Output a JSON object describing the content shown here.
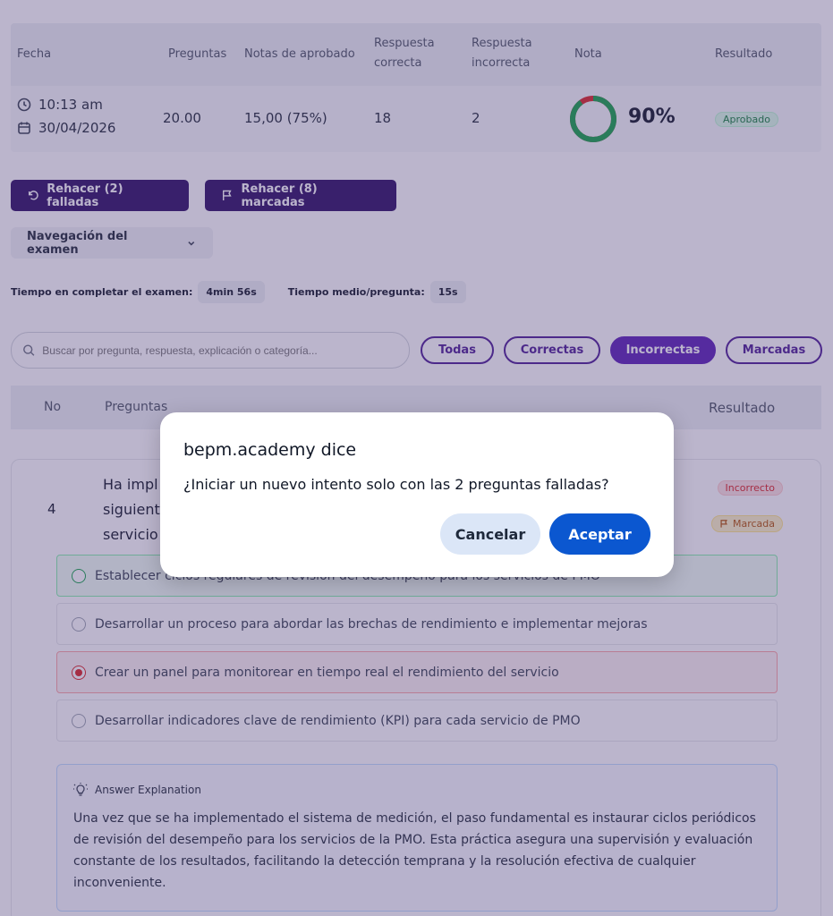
{
  "summary": {
    "headers": {
      "fecha": "Fecha",
      "preguntas": "Preguntas",
      "notas_aprobado": "Notas de aprobado",
      "respuesta_correcta_1": "Respuesta",
      "respuesta_correcta_2": "correcta",
      "respuesta_incorrecta_1": "Respuesta",
      "respuesta_incorrecta_2": "incorrecta",
      "nota": "Nota",
      "resultado": "Resultado"
    },
    "row": {
      "time": "10:13 am",
      "date": "30/04/2026",
      "preguntas": "20.00",
      "notas_aprobado": "15,00 (75%)",
      "correctas": "18",
      "incorrectas": "2",
      "nota_pct": "90%",
      "nota_value": 0.9,
      "resultado": "Aprobado"
    }
  },
  "actions": {
    "retry_failed": "Rehacer (2) falladas",
    "retry_marked": "Rehacer (8) marcadas",
    "exam_nav": "Navegación del examen"
  },
  "timing": {
    "total_label": "Tiempo en completar el examen:",
    "total_value": "4min 56s",
    "avg_label": "Tiempo medio/pregunta:",
    "avg_value": "15s"
  },
  "search": {
    "placeholder": "Buscar por pregunta, respuesta, explicación o categoría..."
  },
  "filters": [
    {
      "label": "Todas"
    },
    {
      "label": "Correctas"
    },
    {
      "label": "Incorrectas",
      "active": true
    },
    {
      "label": "Marcadas"
    }
  ],
  "question_table": {
    "col_no": "No",
    "col_preguntas": "Preguntas",
    "col_resultado": "Resultado"
  },
  "question": {
    "number": "4",
    "text_line1": "Ha impl",
    "text_line2": "siguient",
    "text_line3": "servicio",
    "status": "Incorrecto",
    "flag": "Marcada",
    "options": [
      {
        "text": "Establecer ciclos regulares de revisión del desempeño para los servicios de PMO",
        "state": "correct"
      },
      {
        "text": "Desarrollar un proceso para abordar las brechas de rendimiento e implementar mejoras",
        "state": "none"
      },
      {
        "text": "Crear un panel para monitorear en tiempo real el rendimiento del servicio",
        "state": "wrong"
      },
      {
        "text": "Desarrollar indicadores clave de rendimiento (KPI) para cada servicio de PMO",
        "state": "none"
      }
    ],
    "explanation_title": "Answer Explanation",
    "explanation": "Una vez que se ha implementado el sistema de medición, el paso fundamental es instaurar ciclos periódicos de revisión del desempeño para los servicios de la PMO. Esta práctica asegura una supervisión y evaluación constante de los resultados, facilitando la detección temprana y la resolución efectiva de cualquier inconveniente."
  },
  "dialog": {
    "title": "bepm.academy dice",
    "message": "¿Iniciar un nuevo intento solo con las 2 preguntas falladas?",
    "cancel": "Cancelar",
    "accept": "Aceptar"
  },
  "colors": {
    "primary_dark": "#2e1065",
    "filter_active": "#5b21b6",
    "donut_correct": "#16a34a",
    "donut_wrong": "#dc2626",
    "dialog_accept": "#0b57d0"
  }
}
